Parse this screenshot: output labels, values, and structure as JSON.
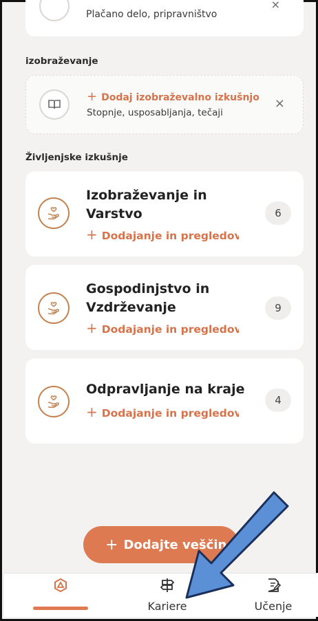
{
  "top_card": {
    "subtitle": "Plačano delo, pripravništvo",
    "close": "×"
  },
  "education": {
    "section_label": "izobraževanje",
    "add_label": "Dodaj izobraževalno izkušnjo",
    "subtitle": "Stopnje, usposabljanja, tečaji",
    "close": "×"
  },
  "life_experience": {
    "section_label": "Življenjske izkušnje",
    "cards": [
      {
        "title_line1": "Izobraževanje in",
        "title_line2": "Varstvo",
        "add_label": "Dodajanje in pregledov",
        "count": "6"
      },
      {
        "title_line1": "Gospodinjstvo in",
        "title_line2": "Vzdrževanje",
        "add_label": "Dodajanje in pregledov",
        "count": "9"
      },
      {
        "title_line1": "Odpravljanje na kraje",
        "title_line2": "",
        "add_label": "Dodajanje in pregledov",
        "count": "4"
      }
    ]
  },
  "fab": {
    "label": "Dodajte veščin"
  },
  "bottom_nav": {
    "items": [
      {
        "label": "",
        "icon": "home-icon",
        "active": true
      },
      {
        "label": "Kariere",
        "icon": "signpost-icon",
        "active": false
      },
      {
        "label": "Učenje",
        "icon": "document-edit-icon",
        "active": false
      }
    ]
  },
  "colors": {
    "accent": "#de7a52",
    "icon_ring": "#c48350",
    "background": "#f3f2f0",
    "arrow": "#5b8fd6"
  }
}
